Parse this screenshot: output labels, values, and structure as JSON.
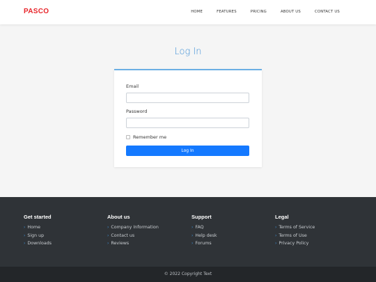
{
  "header": {
    "brand": "PASCO",
    "nav": [
      "HOME",
      "FEATURES",
      "PRICING",
      "ABOUT US",
      "CONTACT US"
    ]
  },
  "login": {
    "title": "Log In",
    "email_label": "Email",
    "email_value": "",
    "password_label": "Password",
    "password_value": "",
    "remember_label": "Remember me",
    "remember_checked": false,
    "submit_label": "Log In"
  },
  "footer": {
    "columns": [
      {
        "title": "Get started",
        "links": [
          "Home",
          "Sign up",
          "Downloads"
        ]
      },
      {
        "title": "About us",
        "links": [
          "Company Information",
          "Contact us",
          "Reviews"
        ]
      },
      {
        "title": "Support",
        "links": [
          "FAQ",
          "Help desk",
          "Forums"
        ]
      },
      {
        "title": "Legal",
        "links": [
          "Terms of Service",
          "Terms of Use",
          "Privacy Policy"
        ]
      }
    ],
    "copyright": "© 2022 Copyright Text"
  },
  "colors": {
    "brand": "#e8252a",
    "accent": "#3d8fd6",
    "button": "#1479ff",
    "footer_bg": "#2f3337",
    "footer_bottom_bg": "#232629"
  }
}
